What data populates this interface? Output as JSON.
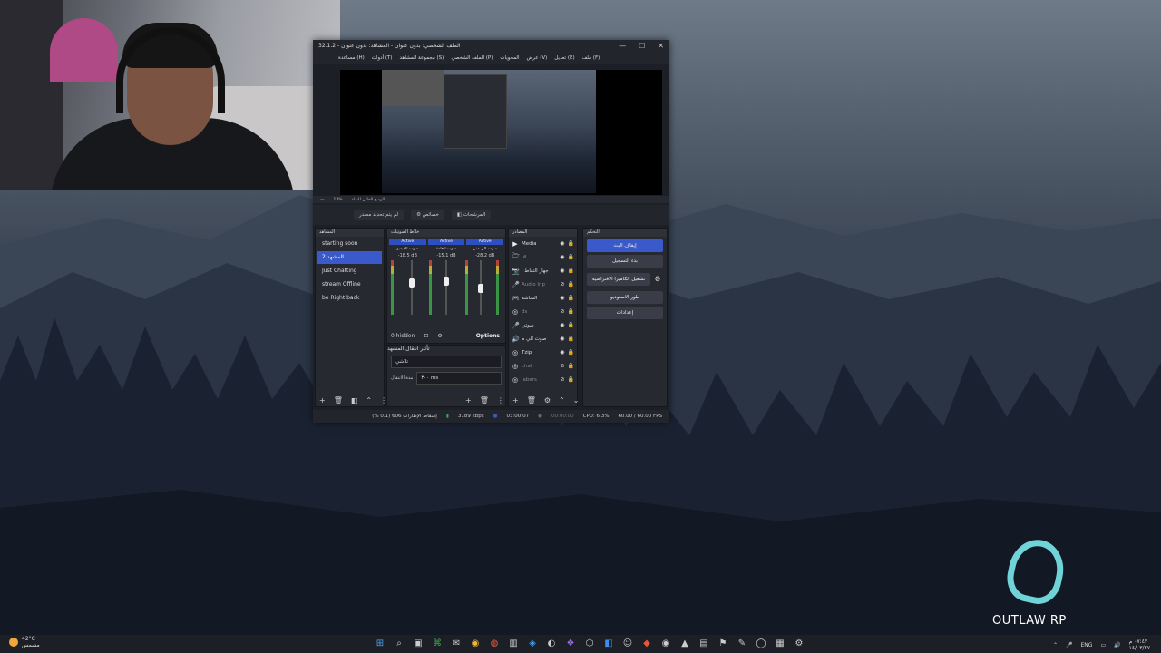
{
  "obs": {
    "title": "الملف الشخصي: بدون عنوان - المشاهد: بدون عنوان - 32.1.2",
    "win_min": "—",
    "win_max": "☐",
    "win_close": "✕",
    "menu": [
      "ملف (F)",
      "تعديل (E)",
      "عرض (V)",
      "المحويات",
      "الملف الشخصي (P)",
      "مجموعة المشاهد (S)",
      "أدوات (T)",
      "مساعدة (H)"
    ],
    "toolbar": {
      "props": "خصائص",
      "filters": "المرشحات",
      "no_source": "لم يتم تحديد مصدر"
    },
    "strip": [
      "—",
      "13%",
      "الوضع الحالي للنقلة"
    ],
    "scenes": {
      "header": "المشاهد",
      "items": [
        "starting soon",
        "المشهد 2",
        "Just Chatting",
        "stream Offline",
        "be Right back"
      ],
      "active_index": 1
    },
    "mixer": {
      "header": "خلاط الصوتيات",
      "channels": [
        {
          "status": "Active",
          "name": "صوت الفيديو",
          "db": "-18.5 dB",
          "level": 0.65
        },
        {
          "status": "Active",
          "name": "صوت العامة",
          "db": "-15.1 dB",
          "level": 0.72
        },
        {
          "status": "Active",
          "name": "صوت الي مني",
          "db": "-28.2 dB",
          "level": 0.45
        }
      ],
      "left_cut": "صوت",
      "hidden": "0 hidden",
      "options": "Options"
    },
    "transitions": {
      "header": "تأثير انتقال المشهد",
      "selected": "تلاشي",
      "duration_label": "مدة الانتقال",
      "duration_value": "٣٠٠ ms"
    },
    "sources": {
      "header": "المصادر",
      "items": [
        {
          "icon": "▶",
          "name": "Media",
          "dim": false
        },
        {
          "icon": "🗁",
          "name": "انا",
          "dim": false
        },
        {
          "icon": "📷",
          "name": "جهاز التقاط ا",
          "dim": false
        },
        {
          "icon": "🎤",
          "name": "Audio Inp",
          "dim": true
        },
        {
          "icon": "🎮",
          "name": "الشاشة",
          "dim": false
        },
        {
          "icon": "◎",
          "name": "ds",
          "dim": true
        },
        {
          "icon": "🎤",
          "name": "سوتي",
          "dim": false
        },
        {
          "icon": "🔊",
          "name": "صوت الي م",
          "dim": false
        },
        {
          "icon": "◎",
          "name": "Tzip",
          "dim": false
        },
        {
          "icon": "◎",
          "name": "chat",
          "dim": true
        },
        {
          "icon": "◎",
          "name": "labers",
          "dim": true
        }
      ]
    },
    "controls": {
      "header": "التحكم",
      "stop_stream": "إيقاف البث",
      "start_record": "بدء التسجيل",
      "virtual_cam": "تشغيل الكاميرا الافتراضية",
      "studio_mode": "طور الاستوديو",
      "settings": "إعدادات"
    },
    "status": {
      "dropped": "إسقاط الإطارات 606 (0.1 %)",
      "bitrate": "3189 kbps",
      "live_time": "03:00:07",
      "rec_time": "00:00:00",
      "cpu": "CPU: 6.3%",
      "fps": "60.00 / 60.00 FPS"
    }
  },
  "logo": {
    "text": "OUTLAW RP"
  },
  "taskbar": {
    "temp": "42°C",
    "weather": "مشمس",
    "lang": "ENG",
    "time": "٠٧:٤٣ م",
    "date": "١٤/٠٣/٢٧",
    "apps": [
      "⊞",
      "⌕",
      "▣",
      "⌘",
      "✉",
      "◉",
      "◍",
      "▥",
      "◈",
      "◐",
      "❖",
      "⬡",
      "◧",
      "☺",
      "◆",
      "◉",
      "▲",
      "▤",
      "⚑",
      "✎",
      "◯",
      "▦",
      "⚙"
    ]
  },
  "colors": {
    "accent": "#3a5acb",
    "logo": "#6fd3d8",
    "meter_green": "#3da84a"
  }
}
